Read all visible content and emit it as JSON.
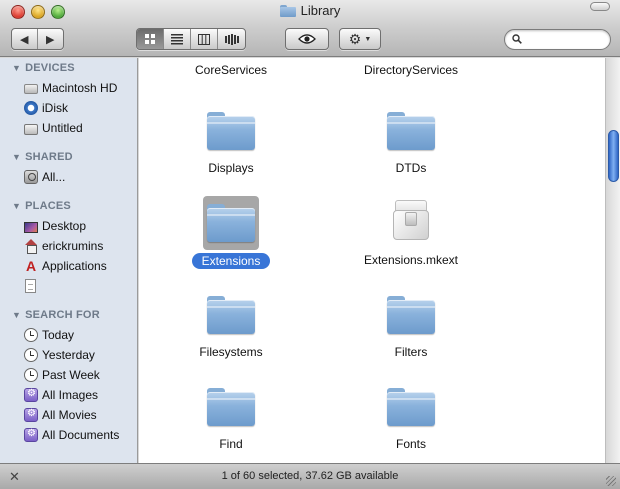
{
  "window": {
    "title": "Library",
    "status": "1 of 60 selected, 37.62 GB available"
  },
  "toolbar": {
    "back_icon": "◀",
    "forward_icon": "▶",
    "view_icons": [
      "icon-view",
      "list-view",
      "column-view",
      "coverflow-view"
    ],
    "quicklook_icon": "eye-icon",
    "action_icon": "gear-icon",
    "search_placeholder": ""
  },
  "sidebar": {
    "devices": {
      "title": "DEVICES",
      "items": [
        {
          "label": "Macintosh HD",
          "icon": "hard-disk-icon"
        },
        {
          "label": "iDisk",
          "icon": "idisk-icon"
        },
        {
          "label": "Untitled",
          "icon": "drive-icon"
        }
      ]
    },
    "shared": {
      "title": "SHARED",
      "items": [
        {
          "label": "All...",
          "icon": "network-icon"
        }
      ]
    },
    "places": {
      "title": "PLACES",
      "items": [
        {
          "label": "Desktop",
          "icon": "desktop-icon"
        },
        {
          "label": "erickrumins",
          "icon": "home-icon"
        },
        {
          "label": "Applications",
          "icon": "applications-icon"
        },
        {
          "label": "",
          "icon": "document-icon"
        }
      ]
    },
    "search_for": {
      "title": "SEARCH FOR",
      "items": [
        {
          "label": "Today",
          "icon": "clock-icon"
        },
        {
          "label": "Yesterday",
          "icon": "clock-icon"
        },
        {
          "label": "Past Week",
          "icon": "clock-icon"
        },
        {
          "label": "All Images",
          "icon": "smart-folder-icon"
        },
        {
          "label": "All Movies",
          "icon": "smart-folder-icon"
        },
        {
          "label": "All Documents",
          "icon": "smart-folder-icon"
        }
      ]
    }
  },
  "files": [
    {
      "name": "CoreServices",
      "type": "folder"
    },
    {
      "name": "DirectoryServices",
      "type": "folder"
    },
    {
      "name": "Displays",
      "type": "folder"
    },
    {
      "name": "DTDs",
      "type": "folder"
    },
    {
      "name": "Extensions",
      "type": "folder",
      "selected": true
    },
    {
      "name": "Extensions.mkext",
      "type": "kext"
    },
    {
      "name": "Filesystems",
      "type": "folder"
    },
    {
      "name": "Filters",
      "type": "folder"
    },
    {
      "name": "Find",
      "type": "folder"
    },
    {
      "name": "Fonts",
      "type": "folder"
    }
  ],
  "colors": {
    "selection": "#3875d7",
    "sidebar_bg": "#dde4ee",
    "folder": "#8ab2dc"
  }
}
